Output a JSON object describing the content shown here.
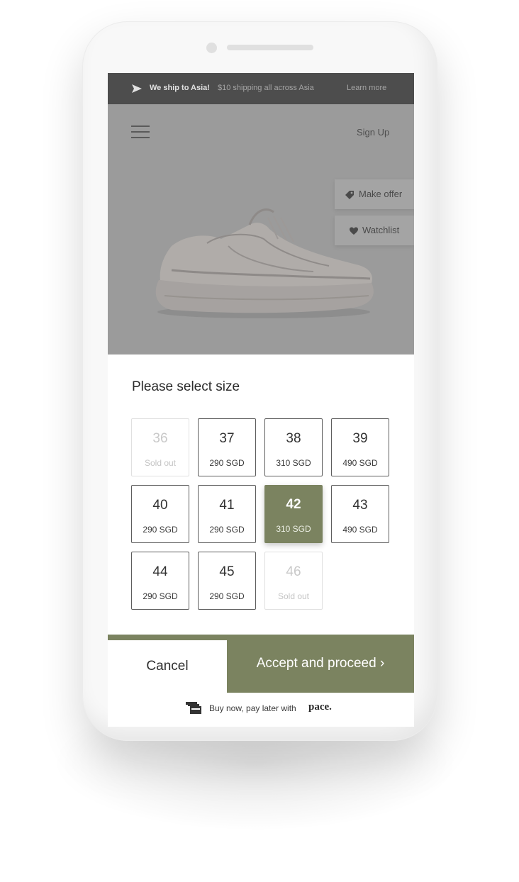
{
  "promo": {
    "icon": "send-icon",
    "bold_text": "We ship to Asia!",
    "text": "$10 shipping all across Asia",
    "link": "Learn more"
  },
  "header": {
    "menu_icon": "hamburger-icon",
    "signup_label": "Sign Up"
  },
  "product": {
    "make_offer_label": "Make offer",
    "make_offer_icon": "tag-icon",
    "watchlist_label": "Watchlist",
    "watchlist_icon": "heart-icon"
  },
  "size_panel": {
    "title": "Please select size",
    "sizes": [
      {
        "size": "36",
        "price": "Sold out",
        "state": "sold-out"
      },
      {
        "size": "37",
        "price": "290 SGD",
        "state": "available"
      },
      {
        "size": "38",
        "price": "310 SGD",
        "state": "available"
      },
      {
        "size": "39",
        "price": "490 SGD",
        "state": "available"
      },
      {
        "size": "40",
        "price": "290 SGD",
        "state": "available"
      },
      {
        "size": "41",
        "price": "290 SGD",
        "state": "available"
      },
      {
        "size": "42",
        "price": "310 SGD",
        "state": "selected"
      },
      {
        "size": "43",
        "price": "490 SGD",
        "state": "available"
      },
      {
        "size": "44",
        "price": "290 SGD",
        "state": "available"
      },
      {
        "size": "45",
        "price": "290 SGD",
        "state": "available"
      },
      {
        "size": "46",
        "price": "Sold out",
        "state": "sold-out"
      }
    ]
  },
  "actions": {
    "cancel_label": "Cancel",
    "accept_label": "Accept and proceed ›"
  },
  "footer": {
    "icon": "cards-icon",
    "text": "Buy now, pay later with",
    "brand": "pace."
  },
  "colors": {
    "accent": "#7b8360",
    "promo_bar": "#4d4d4d",
    "overlay": "#9b9b9b"
  }
}
